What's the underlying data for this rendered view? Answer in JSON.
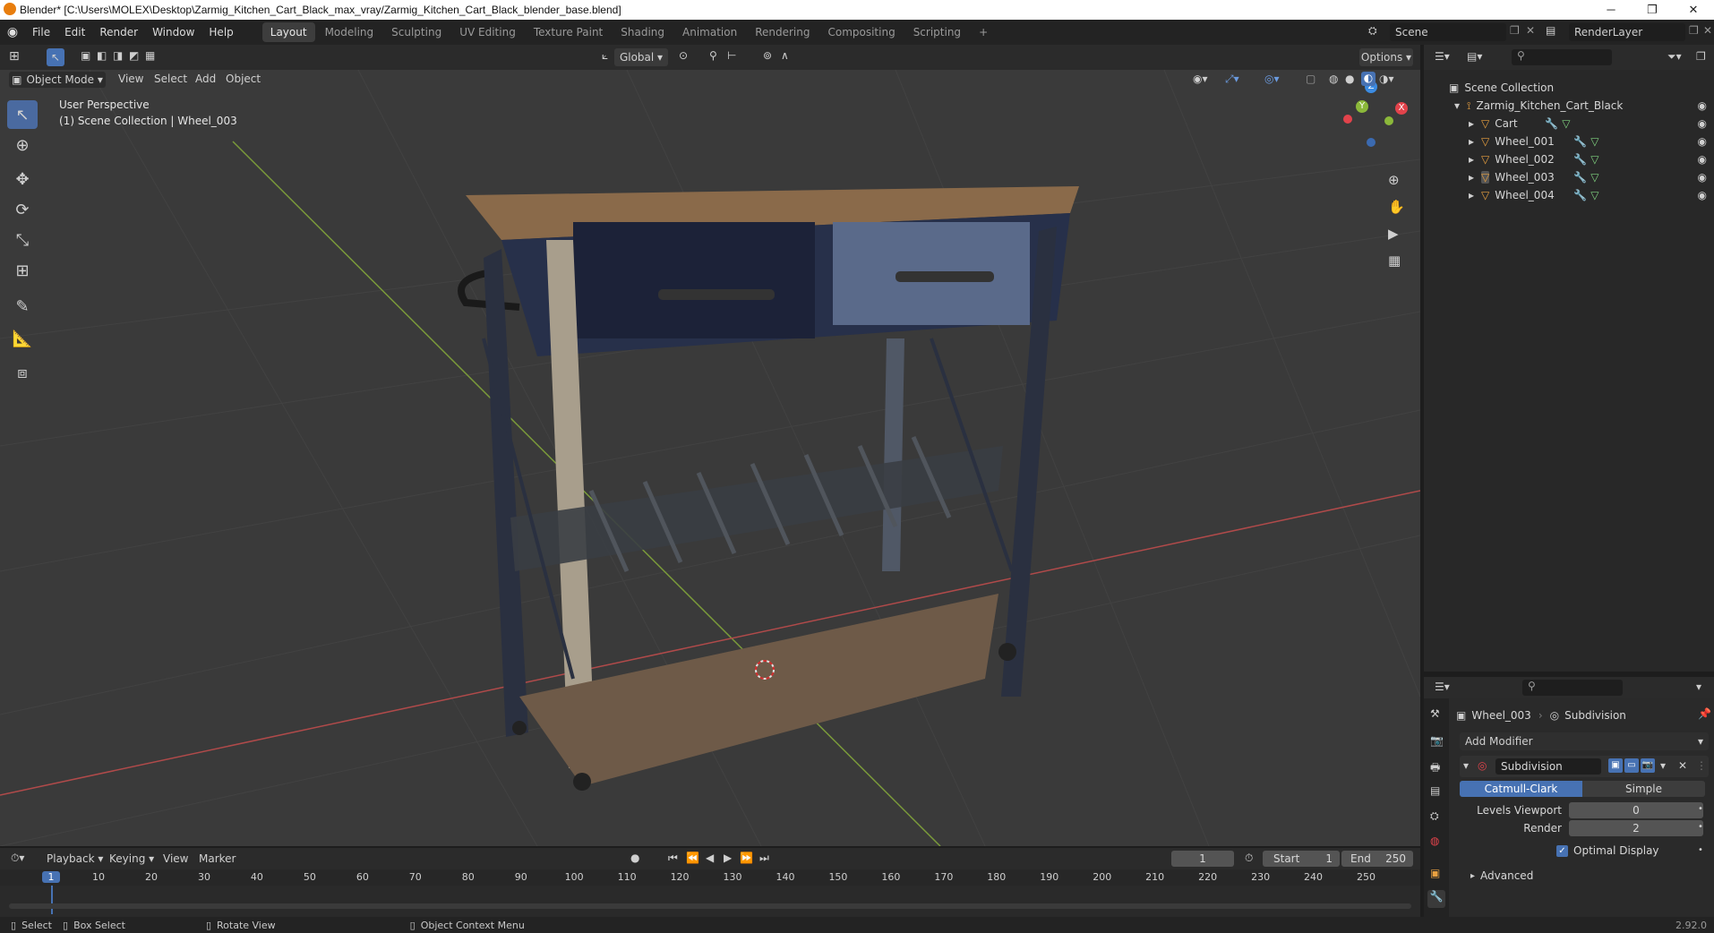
{
  "window": {
    "title": "Blender* [C:\\Users\\MOLEX\\Desktop\\Zarmig_Kitchen_Cart_Black_max_vray/Zarmig_Kitchen_Cart_Black_blender_base.blend]",
    "min": "─",
    "max": "❐",
    "close": "✕"
  },
  "menu": [
    "File",
    "Edit",
    "Render",
    "Window",
    "Help"
  ],
  "workspaces": [
    "Layout",
    "Modeling",
    "Sculpting",
    "UV Editing",
    "Texture Paint",
    "Shading",
    "Animation",
    "Rendering",
    "Compositing",
    "Scripting",
    "+"
  ],
  "scene": {
    "label": "Scene",
    "render_layer": "RenderLayer"
  },
  "viewport": {
    "mode": "Object Mode",
    "menus": [
      "View",
      "Select",
      "Add",
      "Object"
    ],
    "transform": "Global",
    "options": "Options",
    "info_line1": "User Perspective",
    "info_line2": "(1) Scene Collection | Wheel_003",
    "gizmo": {
      "x": "X",
      "y": "Y",
      "z": "Z"
    }
  },
  "outliner": {
    "root": "Scene Collection",
    "collection": "Zarmig_Kitchen_Cart_Black",
    "objects": [
      "Cart",
      "Wheel_001",
      "Wheel_002",
      "Wheel_003",
      "Wheel_004"
    ]
  },
  "properties": {
    "object": "Wheel_003",
    "modifier_crumb": "Subdivision",
    "add_modifier": "Add Modifier",
    "modifier_name": "Subdivision",
    "tab_catmull": "Catmull-Clark",
    "tab_simple": "Simple",
    "levels_viewport_label": "Levels Viewport",
    "levels_viewport_value": "0",
    "render_label": "Render",
    "render_value": "2",
    "optimal_display": "Optimal Display",
    "advanced": "Advanced"
  },
  "timeline": {
    "menus": [
      "Playback",
      "Keying",
      "View",
      "Marker"
    ],
    "current_frame": "1",
    "start_label": "Start",
    "start_value": "1",
    "end_label": "End",
    "end_value": "250",
    "ticks": [
      "1",
      "10",
      "20",
      "30",
      "40",
      "50",
      "60",
      "70",
      "80",
      "90",
      "100",
      "110",
      "120",
      "130",
      "140",
      "150",
      "160",
      "170",
      "180",
      "190",
      "200",
      "210",
      "220",
      "230",
      "240",
      "250"
    ]
  },
  "status": {
    "select": "Select",
    "box_select": "Box Select",
    "rotate_view": "Rotate View",
    "context_menu": "Object Context Menu",
    "version": "2.92.0"
  },
  "colors": {
    "accent": "#4772b3",
    "active_tab": "#3d3d3d",
    "x_axis": "#e2434b",
    "y_axis": "#8bb83a",
    "z_axis": "#3b8be2"
  }
}
